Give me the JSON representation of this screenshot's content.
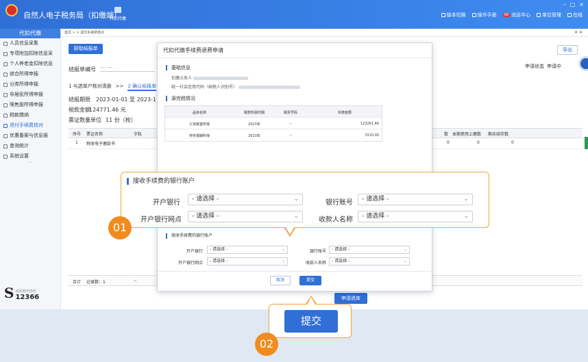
{
  "app": {
    "title": "自然人电子税务局（扣缴端）",
    "module": "代扣代缴",
    "links": [
      "版本切换",
      "操作手册",
      "消息中心",
      "单位管理",
      "在线"
    ],
    "message_badge": "99"
  },
  "sidebar": {
    "header": "代扣代缴",
    "items": [
      "人员信息采集",
      "专项附加扣除信息采",
      "个人养老金扣除信息",
      "综合所得申报",
      "分类所得申报",
      "非居民所得申报",
      "限售股所得申报",
      "税款缴纳",
      "退付手续费核对",
      "优惠备案与信息报",
      "查询统计",
      "系统设置"
    ],
    "active_index": 8,
    "logo_big": "S",
    "logo_small": "纳税服务热线",
    "logo_number": "12366"
  },
  "main": {
    "breadcrumb": "首页 > > 退付手续费核对",
    "get_report_button": "获取结报单",
    "export_button": "导出",
    "settlement_no_label": "结报单编号",
    "settlement_no_value": "— —",
    "apply_status_label": "申请状态",
    "apply_status_value": "申请中",
    "steps": [
      "1 与选单户核对清册",
      ">>",
      "2 确认结报单"
    ],
    "period_label": "结报期限",
    "period_value": "2023-01-01  至  2023-1",
    "tax_amount_label": "税款金额",
    "tax_amount_value": "124771.46 元",
    "cert_count_label": "票证数量单位",
    "cert_count_value": "11 份（枚）",
    "table_headers": [
      "序号",
      "票证名称",
      "字轨",
      "本期使用上缴数",
      "期末结存数"
    ],
    "table_row": [
      "1",
      "税收电子缴款书",
      "",
      "0",
      "0",
      "0"
    ],
    "footer_label": "合计",
    "footer_count": "记录数：1",
    "footer_dash": "--",
    "bottom_button": "申请退库"
  },
  "dialog": {
    "title": "代扣代缴手续费退费申请",
    "basic_info": "基础信息",
    "withholder_label": "扣缴义务人",
    "credit_code_label": "统一社会信用代码（纳税人识别号）",
    "tax_paid": "源完税情况",
    "fee_table": {
      "headers": [
        "品目名称",
        "税款所属时期",
        "税票号码",
        "实缴金额"
      ],
      "rows": [
        [
          "工资薪金所得",
          "2023年",
          "--",
          "123261.46"
        ],
        [
          "劳务报酬所得",
          "2023年",
          "--",
          "1510.00"
        ]
      ]
    },
    "bank_section": "接收手续费的银行账户",
    "bank_fields": {
      "open_bank": "开户银行",
      "account": "银行账号",
      "branch": "开户银行网点",
      "payee": "收款人名称",
      "placeholder": "- 请选择 -"
    },
    "cancel_button": "取消",
    "submit_button": "提交"
  },
  "callouts": {
    "one": {
      "number": "01",
      "section": "接收手续费的银行账户",
      "open_bank": "开户银行",
      "account": "银行账号",
      "branch": "开户银行网点",
      "payee": "收款人名称",
      "placeholder": "- 请选择 -"
    },
    "two": {
      "number": "02",
      "button": "提交"
    }
  },
  "colors": {
    "primary": "#2f6fd6",
    "callout": "#f0a23a",
    "badge": "#f08c1e"
  }
}
